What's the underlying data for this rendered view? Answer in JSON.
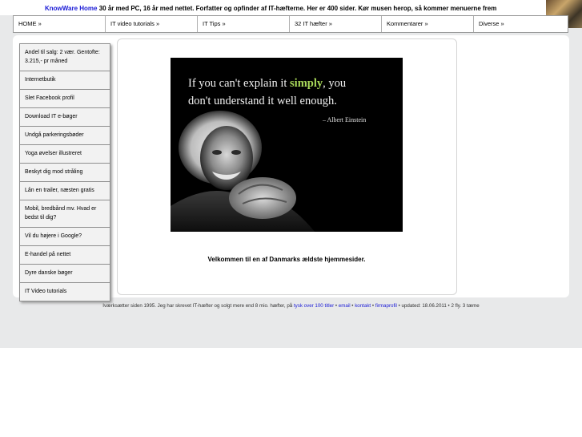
{
  "header": {
    "brand": "KnowWare Home",
    "tagline": "30 år med PC, 16 år med nettet. Forfatter og opfinder af IT-hæfterne. Her er 400 sider. Kør musen herop, så kommer menuerne frem"
  },
  "menu": {
    "items": [
      "HOME »",
      "IT video tutorials »",
      "IT Tips »",
      "32 IT hæfter »",
      "Kommentarer »",
      "Diverse »"
    ]
  },
  "sidebar": {
    "items": [
      "Andel til salg: 2 vær. Gentofte: 3.215,- pr måned",
      "Internetbutik",
      "Slet Facebook profil",
      "Download IT e-bøger",
      "Undgå parkeringsbøder",
      "Yoga øvelser illustreret",
      "Beskyt dig mod stråling",
      "Lån en trailer, næsten gratis",
      "Mobil, bredbånd mv. Hvad er bedst til dig?",
      "Vil du højere i Google?",
      "E-handel på nettet",
      "Dyre danske bøger",
      "IT Video tutorials"
    ]
  },
  "poster": {
    "line1_pre": "If you can't explain it ",
    "line1_em": "simply",
    "line1_post": ", you",
    "line2": "don't understand it well enough.",
    "author": "– Albert Einstein"
  },
  "main": {
    "welcome": "Velkommen til en af Danmarks ældste hjemmesider."
  },
  "footer": {
    "pre": "Iværksætter siden 1995. Jeg har skrevet IT-hæfter og solgt mere end 8 mio. hæfter, på",
    "link_titles": "tysk over 100 titler",
    "sep1": " • ",
    "link_email": "email",
    "sep2": " • ",
    "link_kontakt": "kontakt",
    "sep3": " • ",
    "link_firma": "firmaprofil",
    "post": " • updated: 18.06.2011 • 2 fly. 3 tæme"
  },
  "colors": {
    "background": "#e8e9ea",
    "link": "#1a1ad6",
    "quote_highlight": "#a9d95a"
  }
}
